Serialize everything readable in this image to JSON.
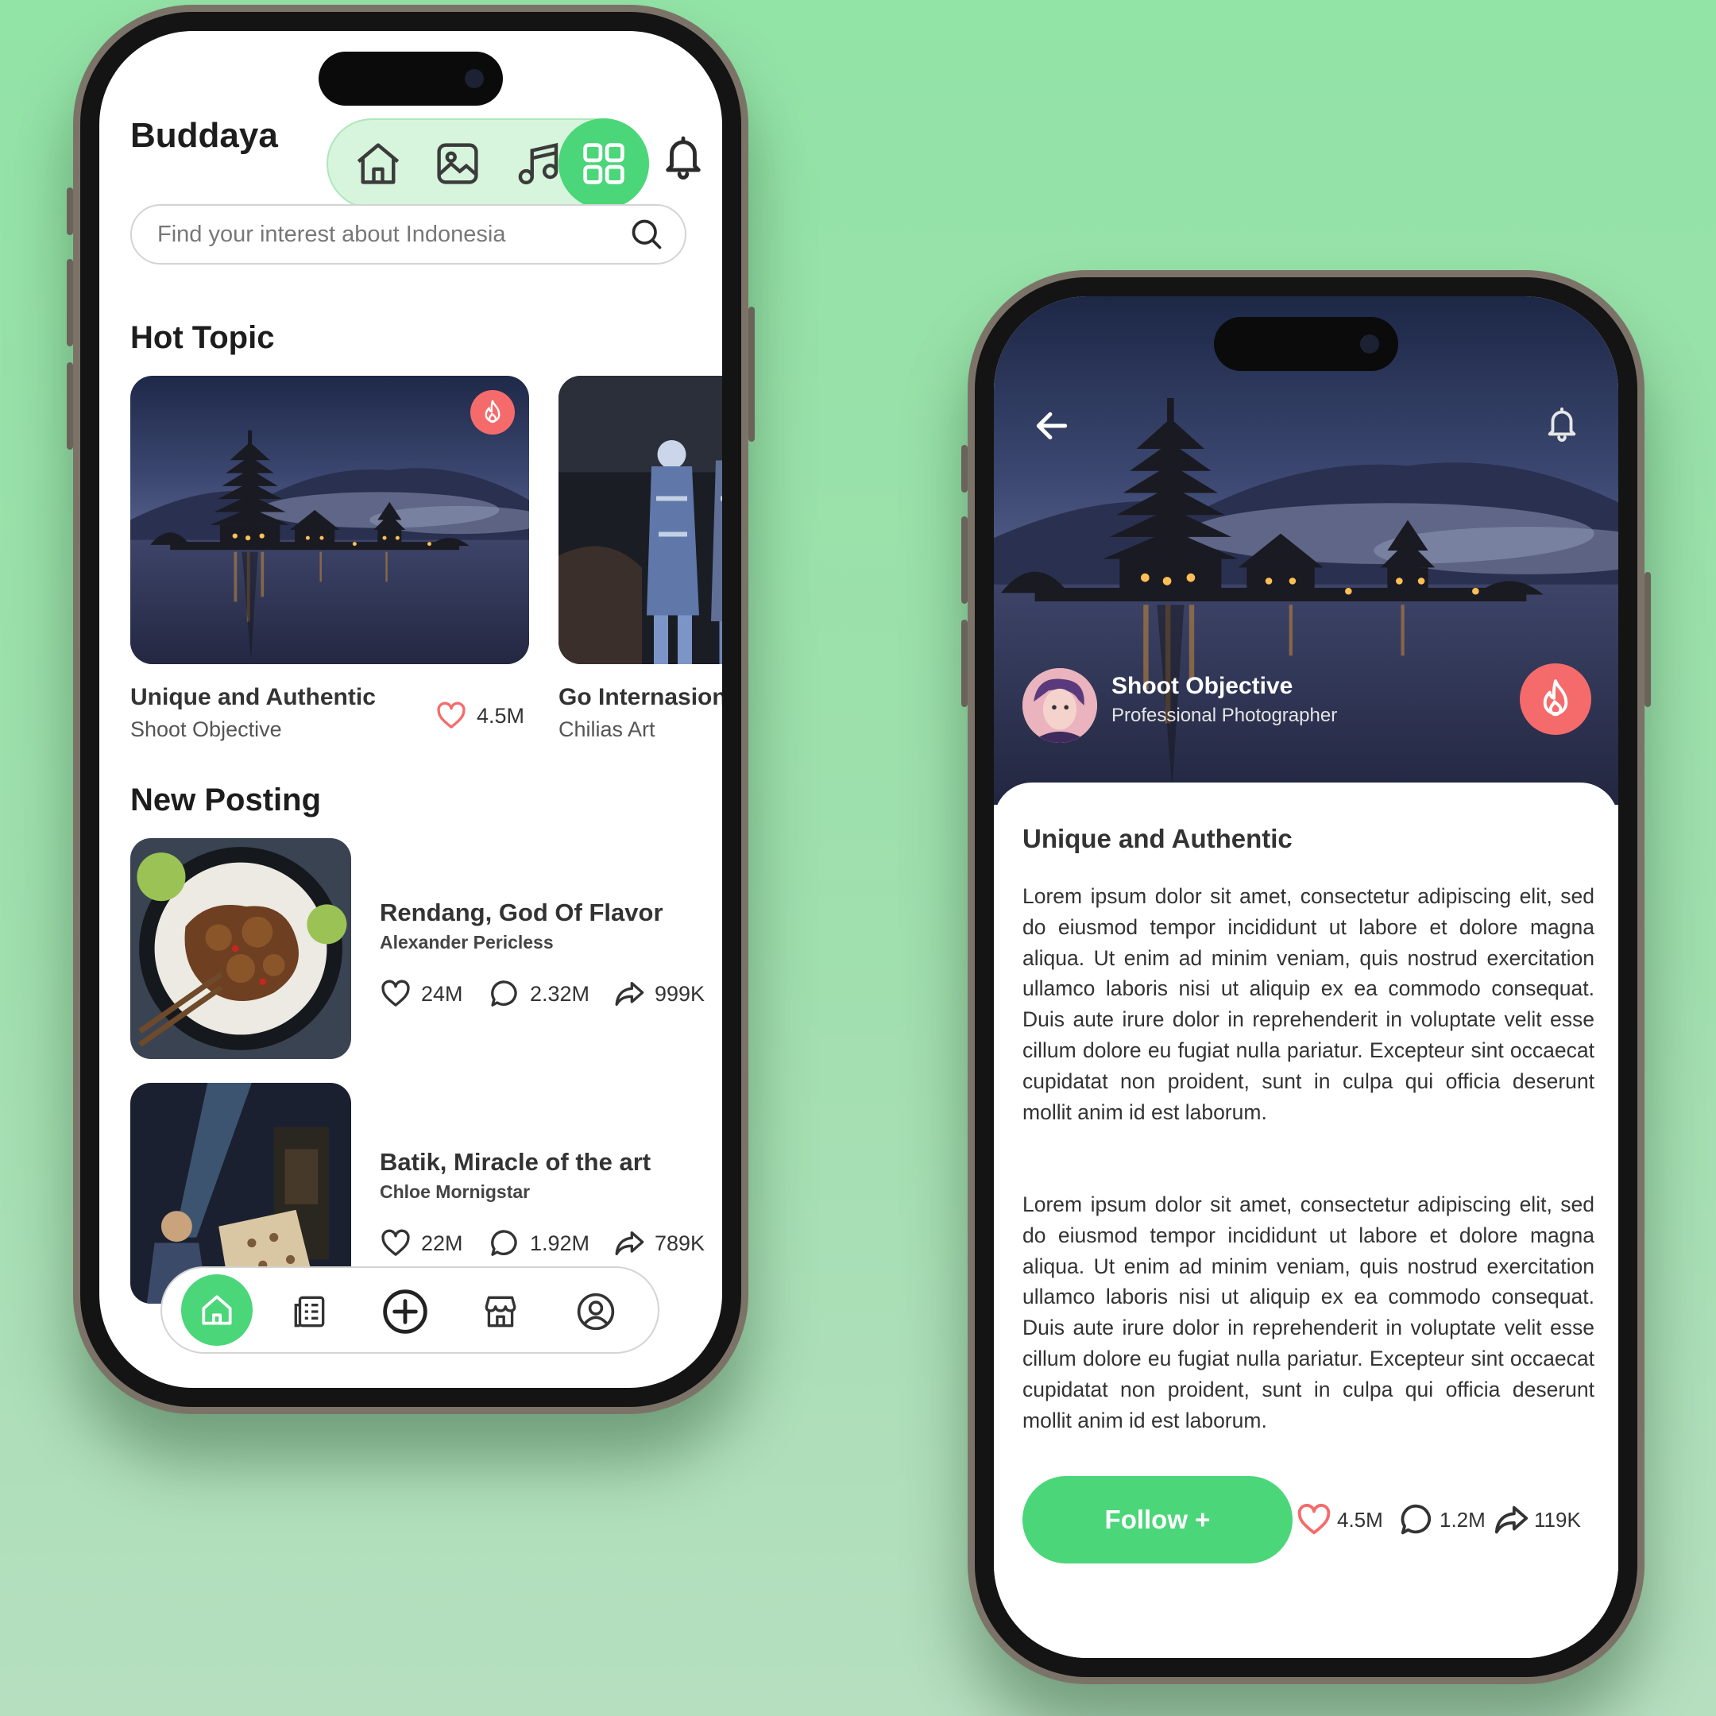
{
  "colors": {
    "accent": "#4ad679",
    "accent_light": "#d7f5dc",
    "hot": "#f56b6b",
    "background": "#9ae2ab"
  },
  "home": {
    "brand": "Buddaya",
    "nav_icons": [
      "home-icon",
      "image-icon",
      "music-icon",
      "grid-icon"
    ],
    "active_nav": "grid-icon",
    "notification_icon": "bell-icon",
    "search": {
      "placeholder": "Find your interest about Indonesia",
      "icon": "search-icon"
    },
    "hot_topic": {
      "title": "Hot Topic",
      "cards": [
        {
          "title": "Unique and Authentic",
          "author": "Shoot Objective",
          "likes": "4.5M",
          "badge": "fire-icon"
        },
        {
          "title": "Go Internasional",
          "author": "Chilias Art"
        }
      ]
    },
    "new_posting": {
      "title": "New Posting",
      "posts": [
        {
          "title": "Rendang, God Of Flavor",
          "author": "Alexander Pericless",
          "likes": "24M",
          "comments": "2.32M",
          "shares": "999K"
        },
        {
          "title": "Batik, Miracle of the art",
          "author": "Chloe Mornigstar",
          "likes": "22M",
          "comments": "1.92M",
          "shares": "789K"
        }
      ]
    },
    "tabbar": [
      "home-icon",
      "news-icon",
      "add-icon",
      "store-icon",
      "profile-icon"
    ],
    "active_tab": "home-icon"
  },
  "detail": {
    "author": {
      "name": "Shoot Objective",
      "role": "Professional Photographer"
    },
    "title": "Unique and Authentic",
    "paragraphs": [
      "Lorem ipsum dolor sit amet, consectetur adipiscing elit, sed do eiusmod tempor incididunt ut labore et dolore magna aliqua. Ut enim ad minim veniam, quis nostrud exercitation ullamco laboris nisi ut aliquip ex ea commodo consequat. Duis aute irure dolor in reprehenderit in voluptate velit esse cillum dolore eu fugiat nulla pariatur. Excepteur sint occaecat cupidatat non proident, sunt in culpa qui officia deserunt mollit anim id est laborum.",
      "Lorem ipsum dolor sit amet, consectetur adipiscing elit, sed do eiusmod tempor incididunt ut labore et dolore magna aliqua. Ut enim ad minim veniam, quis nostrud exercitation ullamco laboris nisi ut aliquip ex ea commodo consequat. Duis aute irure dolor in reprehenderit in voluptate velit esse cillum dolore eu fugiat nulla pariatur. Excepteur sint occaecat cupidatat non proident, sunt in culpa qui officia deserunt mollit anim id est laborum."
    ],
    "follow_label": "Follow +",
    "likes": "4.5M",
    "comments": "1.2M",
    "shares": "119K"
  }
}
